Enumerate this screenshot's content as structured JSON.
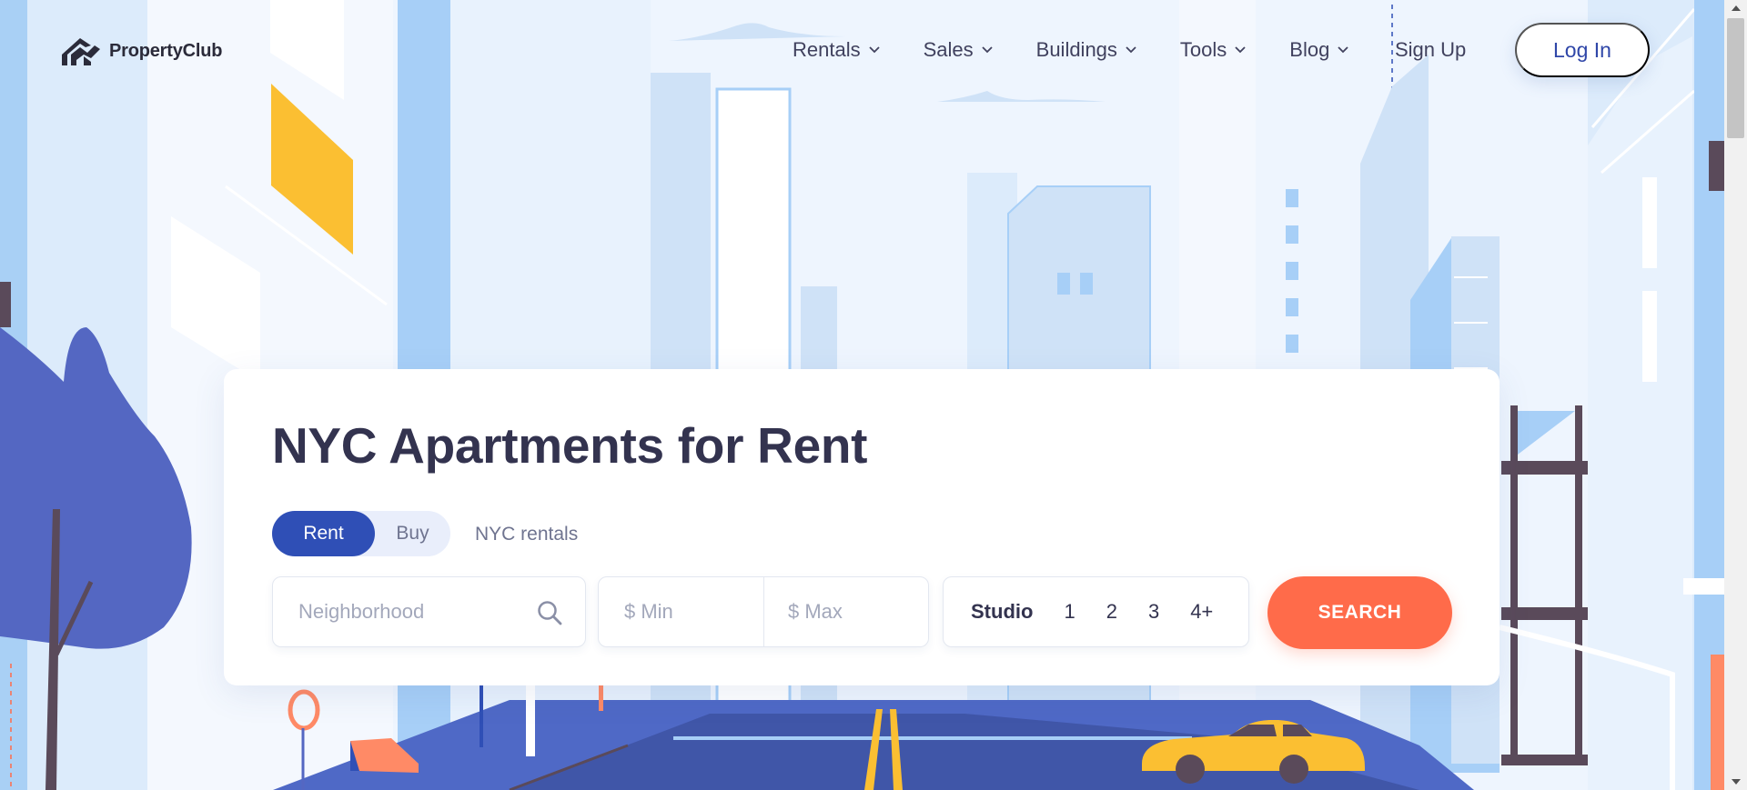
{
  "brand": {
    "name": "PropertyClub"
  },
  "nav": {
    "items": [
      {
        "label": "Rentals"
      },
      {
        "label": "Sales"
      },
      {
        "label": "Buildings"
      },
      {
        "label": "Tools"
      },
      {
        "label": "Blog"
      }
    ],
    "signup_label": "Sign Up",
    "login_label": "Log In"
  },
  "hero": {
    "title": "NYC Apartments for Rent",
    "toggle": {
      "rent_label": "Rent",
      "buy_label": "Buy",
      "active": "Rent"
    },
    "subtitle_link": "NYC rentals",
    "search": {
      "neighborhood_placeholder": "Neighborhood",
      "min_placeholder": "$ Min",
      "max_placeholder": "$ Max",
      "bedrooms": [
        "Studio",
        "1",
        "2",
        "3",
        "4+"
      ],
      "button_label": "SEARCH"
    }
  },
  "colors": {
    "primary": "#2f4fb6",
    "accent": "#ff6b4a",
    "title_text": "#33334f",
    "taxi": "#fbbf32",
    "road": "#4056a8",
    "sky": "#eef5fe"
  }
}
